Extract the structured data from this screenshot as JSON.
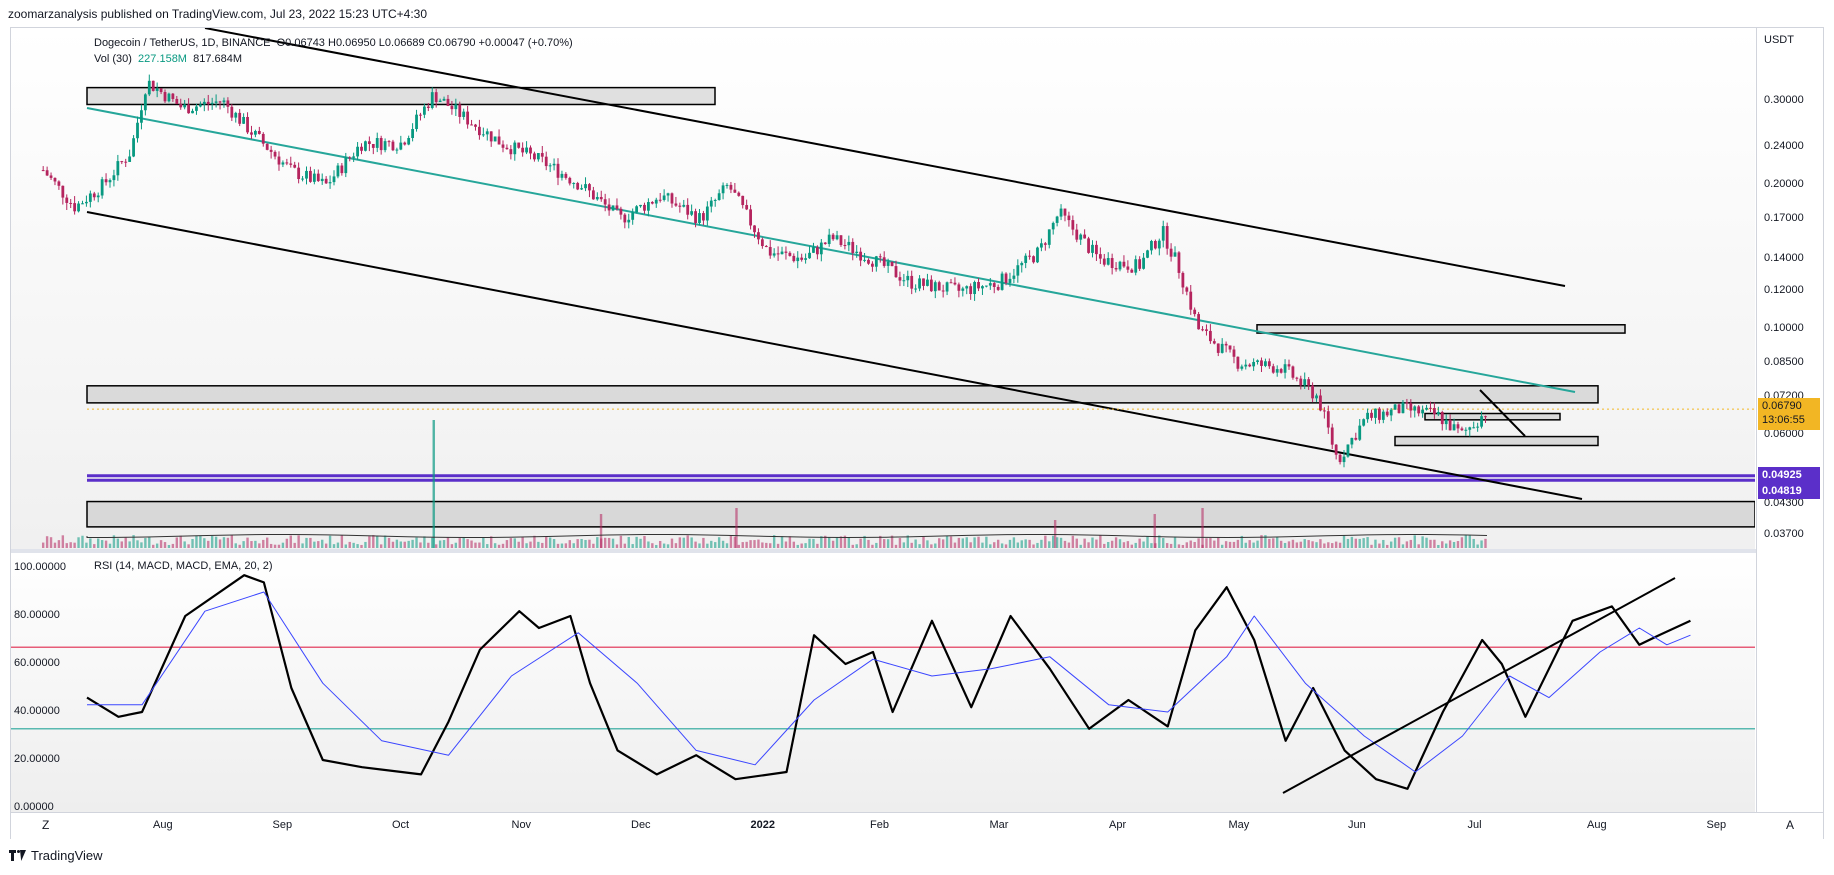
{
  "header": {
    "published": "zoomarzanalysis published on TradingView.com, Jul 23, 2022 15:23 UTC+4:30"
  },
  "legend": {
    "symbol": "Dogecoin / TetherUS, 1D, BINANCE",
    "open": "O0.06743",
    "high": "H0.06950",
    "low": "L0.06689",
    "close": "C0.06790",
    "change": "+0.00047 (+0.70%)",
    "volume_label": "Vol (30)",
    "volume_value": "227.158M",
    "volume_ma": "817.684M",
    "rsi_label": "RSI (14, MACD, MACD, EMA, 20, 2)"
  },
  "price_axis": {
    "currency": "USDT",
    "ticks": [
      "0.30000",
      "0.24000",
      "0.20000",
      "0.17000",
      "0.14000",
      "0.12000",
      "0.10000",
      "0.08500",
      "0.07200",
      "0.06000",
      "0.04300",
      "0.03700"
    ],
    "current_price": "0.06790",
    "countdown": "13:06:55",
    "level_1": "0.04925",
    "level_2": "0.04819"
  },
  "rsi_axis": {
    "ticks": [
      "100.00000",
      "80.00000",
      "60.00000",
      "40.00000",
      "20.00000",
      "0.00000"
    ]
  },
  "time_axis": {
    "ticks": [
      "Aug",
      "Sep",
      "Oct",
      "Nov",
      "Dec",
      "2022",
      "Feb",
      "Mar",
      "Apr",
      "May",
      "Jun",
      "Jul",
      "Aug",
      "Sep"
    ],
    "left_button": "Z",
    "right_button": "A"
  },
  "footer": {
    "brand": "TradingView"
  },
  "colors": {
    "up": "#089981",
    "down": "#b5245e",
    "teal_line": "#26a69a",
    "purple_level": "#6a3cc8",
    "rsi_upper": "#e0284d",
    "rsi_lower": "#26a69a",
    "rsi_signal": "#3b46ff",
    "price_tag": "#f2b624"
  },
  "chart_data": [
    {
      "type": "candlestick",
      "title": "Dogecoin / TetherUS, 1D, BINANCE",
      "x_ticks": [
        "Aug",
        "Sep",
        "Oct",
        "Nov",
        "Dec",
        "2022",
        "Feb",
        "Mar",
        "Apr",
        "May",
        "Jun",
        "Jul",
        "Aug",
        "Sep"
      ],
      "y_scale": "log",
      "y_ticks": [
        0.3,
        0.24,
        0.2,
        0.17,
        0.14,
        0.12,
        0.1,
        0.085,
        0.072,
        0.06,
        0.043,
        0.037
      ],
      "ylim": [
        0.035,
        0.34
      ],
      "last": {
        "open": 0.06743,
        "high": 0.0695,
        "low": 0.06689,
        "close": 0.0679,
        "change": 0.00047,
        "change_pct": 0.7
      },
      "path": [
        [
          "Jul 20",
          0.215
        ],
        [
          "Jul 28",
          0.18
        ],
        [
          "Aug 5",
          0.2
        ],
        [
          "Aug 12",
          0.235
        ],
        [
          "Aug 16",
          0.33
        ],
        [
          "Aug 25",
          0.29
        ],
        [
          "Sep 5",
          0.3
        ],
        [
          "Sep 12",
          0.26
        ],
        [
          "Sep 22",
          0.215
        ],
        [
          "Oct 1",
          0.2
        ],
        [
          "Oct 10",
          0.245
        ],
        [
          "Oct 20",
          0.245
        ],
        [
          "Oct 28",
          0.31
        ],
        [
          "Nov 5",
          0.28
        ],
        [
          "Nov 15",
          0.245
        ],
        [
          "Nov 25",
          0.225
        ],
        [
          "Dec 5",
          0.2
        ],
        [
          "Dec 15",
          0.17
        ],
        [
          "Dec 25",
          0.19
        ],
        [
          "Jan 5",
          0.17
        ],
        [
          "Jan 12",
          0.2
        ],
        [
          "Jan 22",
          0.145
        ],
        [
          "Feb 1",
          0.14
        ],
        [
          "Feb 8",
          0.155
        ],
        [
          "Feb 18",
          0.14
        ],
        [
          "Feb 28",
          0.125
        ],
        [
          "Mar 10",
          0.12
        ],
        [
          "Mar 20",
          0.125
        ],
        [
          "Mar 30",
          0.145
        ],
        [
          "Apr 5",
          0.175
        ],
        [
          "Apr 15",
          0.14
        ],
        [
          "Apr 25",
          0.135
        ],
        [
          "May 1",
          0.16
        ],
        [
          "May 5",
          0.135
        ],
        [
          "May 10",
          0.1
        ],
        [
          "May 20",
          0.085
        ],
        [
          "Jun 1",
          0.083
        ],
        [
          "Jun 10",
          0.072
        ],
        [
          "Jun 15",
          0.053
        ],
        [
          "Jun 22",
          0.065
        ],
        [
          "Jul 1",
          0.068
        ],
        [
          "Jul 10",
          0.066
        ],
        [
          "Jul 16",
          0.06
        ],
        [
          "Jul 23",
          0.0679
        ]
      ],
      "volume_spikes": [
        "Oct 28",
        "Dec 10",
        "Jan 14",
        "Apr 4",
        "Apr 29",
        "May 11"
      ],
      "zones": [
        {
          "from": 0.295,
          "to": 0.32
        },
        {
          "from": 0.07,
          "to": 0.076
        },
        {
          "from": 0.098,
          "to": 0.102
        },
        {
          "from": 0.0645,
          "to": 0.0665
        },
        {
          "from": 0.057,
          "to": 0.0595
        },
        {
          "from": 0.0385,
          "to": 0.0435
        }
      ],
      "levels": [
        0.04925,
        0.04819
      ]
    },
    {
      "type": "line",
      "title": "RSI (14, MACD, MACD, EMA, 20, 2)",
      "ylim": [
        0,
        100
      ],
      "y_ticks": [
        100,
        80,
        60,
        40,
        20,
        0
      ],
      "bands": [
        67,
        33
      ],
      "series": [
        {
          "values": [
            [
              0,
              46
            ],
            [
              8,
              38
            ],
            [
              14,
              40
            ],
            [
              25,
              80
            ],
            [
              40,
              97
            ],
            [
              45,
              94
            ],
            [
              52,
              50
            ],
            [
              60,
              20
            ],
            [
              70,
              17
            ],
            [
              85,
              14
            ],
            [
              92,
              36
            ],
            [
              100,
              66
            ],
            [
              110,
              82
            ],
            [
              115,
              75
            ],
            [
              123,
              80
            ],
            [
              128,
              52
            ],
            [
              135,
              24
            ],
            [
              145,
              14
            ],
            [
              155,
              22
            ],
            [
              165,
              12
            ],
            [
              178,
              15
            ],
            [
              185,
              72
            ],
            [
              193,
              60
            ],
            [
              200,
              65
            ],
            [
              205,
              40
            ],
            [
              215,
              78
            ],
            [
              225,
              42
            ],
            [
              235,
              80
            ],
            [
              245,
              58
            ],
            [
              255,
              33
            ],
            [
              265,
              45
            ],
            [
              275,
              34
            ],
            [
              282,
              74
            ],
            [
              290,
              92
            ],
            [
              297,
              70
            ],
            [
              305,
              28
            ],
            [
              312,
              50
            ],
            [
              320,
              24
            ],
            [
              328,
              12
            ],
            [
              336,
              8
            ],
            [
              345,
              40
            ],
            [
              355,
              70
            ],
            [
              360,
              60
            ],
            [
              366,
              38
            ],
            [
              372,
              58
            ],
            [
              378,
              78
            ],
            [
              388,
              84
            ],
            [
              395,
              68
            ],
            [
              400,
              72
            ],
            [
              408,
              78
            ]
          ]
        },
        {
          "values": [
            [
              0,
              43
            ],
            [
              14,
              43
            ],
            [
              30,
              82
            ],
            [
              45,
              90
            ],
            [
              60,
              52
            ],
            [
              75,
              28
            ],
            [
              92,
              22
            ],
            [
              108,
              55
            ],
            [
              125,
              73
            ],
            [
              140,
              52
            ],
            [
              155,
              24
            ],
            [
              170,
              18
            ],
            [
              185,
              45
            ],
            [
              200,
              62
            ],
            [
              215,
              55
            ],
            [
              230,
              58
            ],
            [
              245,
              63
            ],
            [
              260,
              43
            ],
            [
              275,
              40
            ],
            [
              290,
              63
            ],
            [
              297,
              80
            ],
            [
              310,
              52
            ],
            [
              325,
              30
            ],
            [
              338,
              15
            ],
            [
              350,
              30
            ],
            [
              362,
              55
            ],
            [
              372,
              46
            ],
            [
              385,
              65
            ],
            [
              395,
              75
            ],
            [
              402,
              68
            ],
            [
              408,
              72
            ]
          ]
        }
      ]
    }
  ]
}
